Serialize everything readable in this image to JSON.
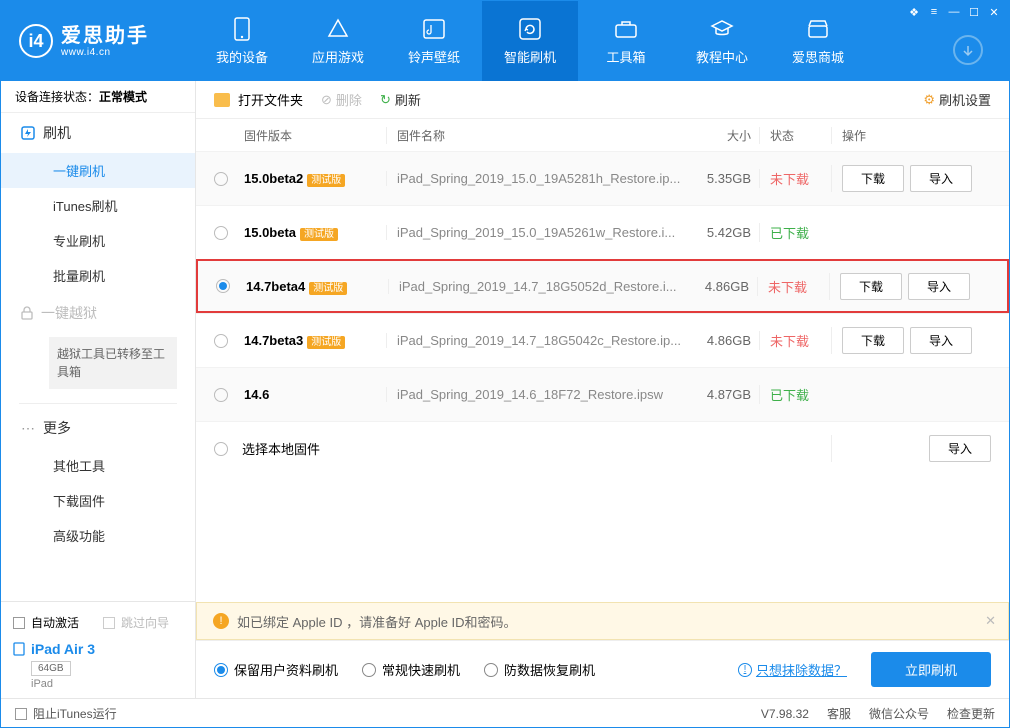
{
  "brand": {
    "cn": "爱思助手",
    "en": "www.i4.cn",
    "logo_letter": "i4"
  },
  "win_controls": [
    "❖",
    "≡",
    "—",
    "☐",
    "✕"
  ],
  "nav": [
    {
      "label": "我的设备"
    },
    {
      "label": "应用游戏"
    },
    {
      "label": "铃声壁纸"
    },
    {
      "label": "智能刷机"
    },
    {
      "label": "工具箱"
    },
    {
      "label": "教程中心"
    },
    {
      "label": "爱思商城"
    }
  ],
  "sidebar": {
    "status_label": "设备连接状态：",
    "status_value": "正常模式",
    "group_flash": {
      "title": "刷机"
    },
    "items": [
      "一键刷机",
      "iTunes刷机",
      "专业刷机",
      "批量刷机"
    ],
    "group_jailbreak": {
      "title": "一键越狱"
    },
    "jailbreak_note": "越狱工具已转移至工具箱",
    "group_more": {
      "title": "更多"
    },
    "more_items": [
      "其他工具",
      "下载固件",
      "高级功能"
    ],
    "auto_activate": "自动激活",
    "skip_guide": "跳过向导",
    "device_name": "iPad Air 3",
    "device_capacity": "64GB",
    "device_type": "iPad"
  },
  "toolbar": {
    "open_folder": "打开文件夹",
    "delete": "删除",
    "refresh": "刷新",
    "settings": "刷机设置"
  },
  "table": {
    "headers": {
      "ver": "固件版本",
      "name": "固件名称",
      "size": "大小",
      "status": "状态",
      "action": "操作"
    },
    "badge_text": "测试版",
    "btn_download": "下载",
    "btn_import": "导入",
    "rows": [
      {
        "ver": "15.0beta2",
        "badge": true,
        "name": "iPad_Spring_2019_15.0_19A5281h_Restore.ip...",
        "size": "5.35GB",
        "status": "未下载",
        "status_color": "red",
        "download": true,
        "import": true
      },
      {
        "ver": "15.0beta",
        "badge": true,
        "name": "iPad_Spring_2019_15.0_19A5261w_Restore.i...",
        "size": "5.42GB",
        "status": "已下载",
        "status_color": "green",
        "download": false,
        "import": false
      },
      {
        "ver": "14.7beta4",
        "badge": true,
        "name": "iPad_Spring_2019_14.7_18G5052d_Restore.i...",
        "size": "4.86GB",
        "status": "未下载",
        "status_color": "red",
        "download": true,
        "import": true,
        "selected": true,
        "highlight": true
      },
      {
        "ver": "14.7beta3",
        "badge": true,
        "name": "iPad_Spring_2019_14.7_18G5042c_Restore.ip...",
        "size": "4.86GB",
        "status": "未下载",
        "status_color": "red",
        "download": true,
        "import": true
      },
      {
        "ver": "14.6",
        "badge": false,
        "name": "iPad_Spring_2019_14.6_18F72_Restore.ipsw",
        "size": "4.87GB",
        "status": "已下载",
        "status_color": "green",
        "download": false,
        "import": false
      }
    ],
    "local_row": "选择本地固件"
  },
  "warning": "如已绑定 Apple ID ，请准备好 Apple ID和密码。",
  "options": {
    "keep_data": "保留用户资料刷机",
    "normal": "常规快速刷机",
    "anti_recovery": "防数据恢复刷机",
    "erase_link": "只想抹除数据？",
    "flash_now": "立即刷机"
  },
  "footer": {
    "block_itunes": "阻止iTunes运行",
    "version": "V7.98.32",
    "service": "客服",
    "wechat": "微信公众号",
    "check_update": "检查更新"
  }
}
